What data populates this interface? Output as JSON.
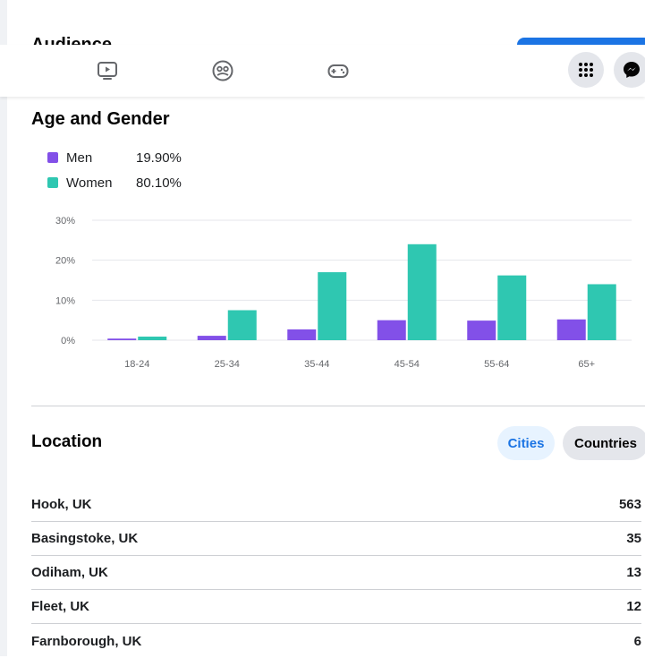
{
  "audience_heading": "Audience",
  "navbar": {
    "icons": [
      "video-icon",
      "groups-icon",
      "gaming-icon",
      "menu-grid-icon",
      "messenger-icon"
    ]
  },
  "age_gender": {
    "title": "Age and Gender",
    "legend": [
      {
        "name": "Men",
        "value": "19.90%",
        "color": "#8250e8"
      },
      {
        "name": "Women",
        "value": "80.10%",
        "color": "#2fc7b1"
      }
    ]
  },
  "chart_data": {
    "type": "bar",
    "categories": [
      "18-24",
      "25-34",
      "35-44",
      "45-54",
      "55-64",
      "65+"
    ],
    "series": [
      {
        "name": "Men",
        "values": [
          0.4,
          1.1,
          2.7,
          5.0,
          4.9,
          5.2
        ],
        "color": "#8250e8"
      },
      {
        "name": "Women",
        "values": [
          0.9,
          7.5,
          17.0,
          24.0,
          16.2,
          14.0
        ],
        "color": "#2fc7b1"
      }
    ],
    "yticks": [
      "0%",
      "10%",
      "20%",
      "30%"
    ],
    "ylim": [
      0,
      30
    ],
    "grid": true,
    "xlabel": "",
    "ylabel": ""
  },
  "location": {
    "title": "Location",
    "tabs": [
      "Cities",
      "Countries"
    ],
    "active_tab": "Cities",
    "rows": [
      {
        "name": "Hook, UK",
        "count": "563"
      },
      {
        "name": "Basingstoke, UK",
        "count": "35"
      },
      {
        "name": "Odiham, UK",
        "count": "13"
      },
      {
        "name": "Fleet, UK",
        "count": "12"
      },
      {
        "name": "Farnborough, UK",
        "count": "6"
      }
    ]
  }
}
